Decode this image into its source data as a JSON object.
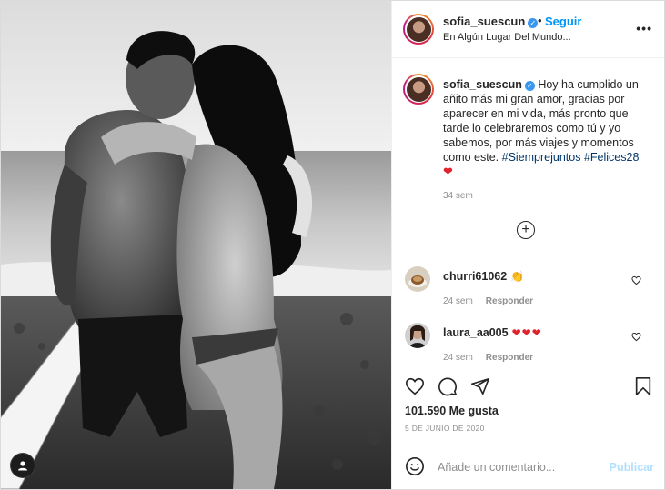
{
  "post": {
    "username": "sofia_suescun",
    "verified_mark": "✓",
    "dot": "•",
    "follow_label": "Seguir",
    "location": "En Algún Lugar Del Mundo...",
    "more_label": "•••",
    "photo_description_icon": "photo-of-couple-on-beach"
  },
  "caption": {
    "username": "sofia_suescun",
    "text": "Hoy ha cumplido un añito más mi gran amor, gracias por aparecer en mi vida, más pronto que tarde lo celebraremos como tú y yo sabemos, por más viajes y momentos como este.",
    "hashtags": "#Siemprejuntos #Felices28",
    "emoji": "❤",
    "time": "34 sem"
  },
  "load_more_icon": "+",
  "comments": [
    {
      "username": "churri61062",
      "text": "👏",
      "time": "24 sem",
      "reply_label": "Responder"
    },
    {
      "username": "laura_aa005",
      "text": "❤❤❤",
      "time": "24 sem",
      "reply_label": "Responder"
    }
  ],
  "actions": {
    "likes": "101.590 Me gusta",
    "date": "5 DE JUNIO DE 2020"
  },
  "comment_box": {
    "placeholder": "Añade un comentario...",
    "publish_label": "Publicar"
  },
  "colors": {
    "accent": "#0095f6",
    "verified": "#3897f0",
    "heart": "#e0222b",
    "publish_disabled": "#b2dffc"
  }
}
